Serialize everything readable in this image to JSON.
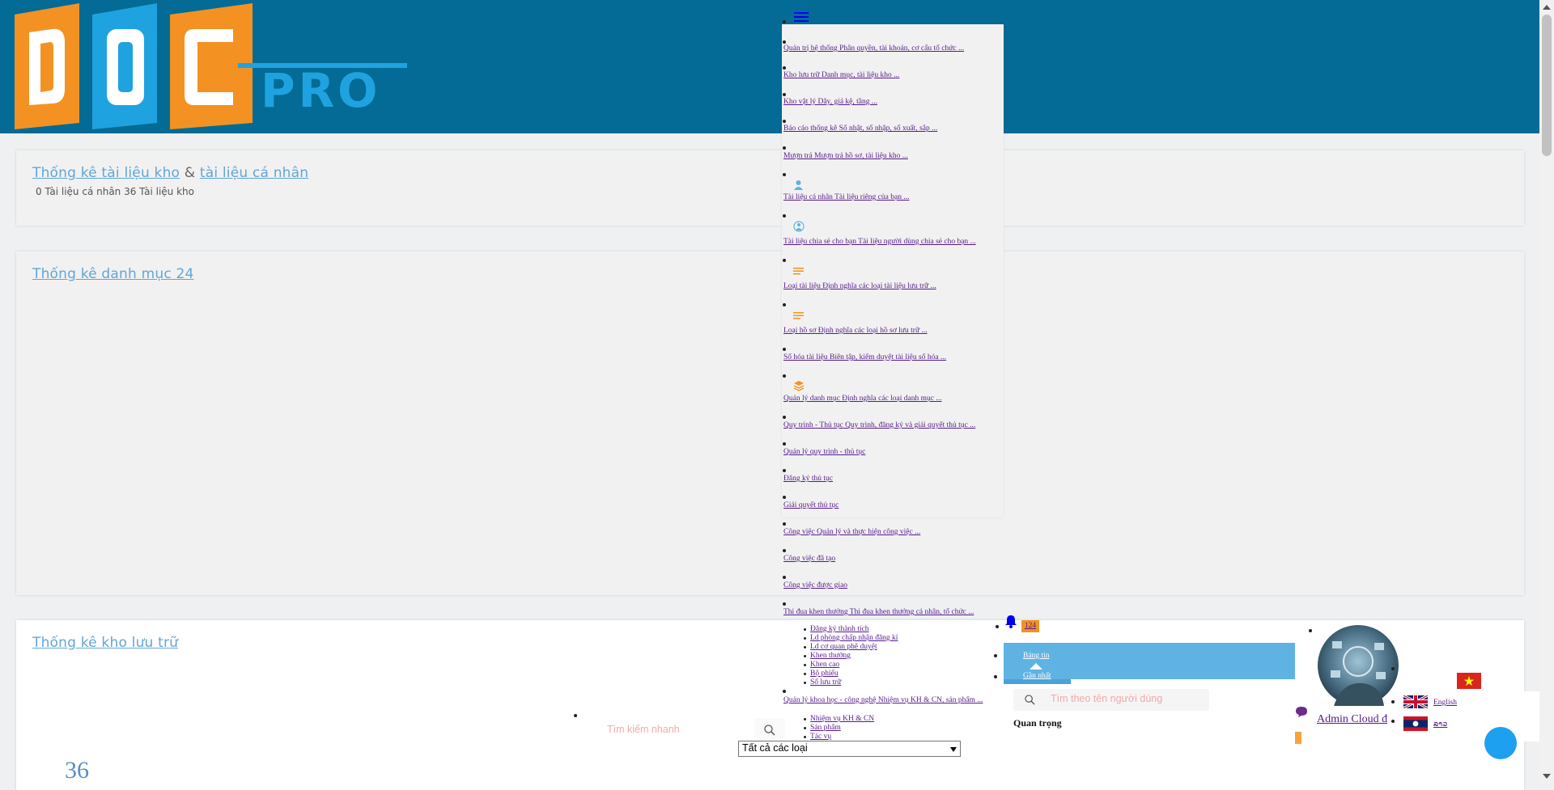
{
  "brand": {
    "logo_text": "DOC PRO",
    "colors": {
      "header": "#036b95",
      "orange": "#f39222",
      "blue": "#1fa2e0",
      "link": "#62a6d6"
    }
  },
  "header": {
    "menu_icon": "hamburger-icon"
  },
  "stats_card": {
    "title_link1": "Thống kê tài liệu kho",
    "amp": "&",
    "title_link2": "tài liệu cá nhân",
    "subtitle": "0 Tài liệu cá nhân  36 Tài liệu kho"
  },
  "category_card": {
    "title": "Thống kê danh mục 24"
  },
  "storage_card": {
    "title": "Thống kê kho lưu trữ",
    "count": "36"
  },
  "menu": {
    "items": [
      {
        "label": "Quản trị hệ thống Phân quyền, tài khoản, cơ cấu tổ chức ..."
      },
      {
        "label": "Kho lưu trữ Danh mục, tài liệu kho ..."
      },
      {
        "label": "Kho vật lý Dãy, giá kệ, tầng ..."
      },
      {
        "label": "Báo cáo thống kê Số nhật, số nhập, số xuất, sắp ..."
      },
      {
        "label": "Mượn trả Mượn trả hồ sơ, tài liệu kho ..."
      },
      {
        "label": "Tài liệu cá nhân Tài liệu riêng của bạn ..."
      },
      {
        "label": "Tài liệu chia sẻ cho bạn Tài liệu người dùng chia sẻ cho bạn ..."
      },
      {
        "label": "Loại tài liệu Định nghĩa các loại tài liệu lưu trữ ..."
      },
      {
        "label": "Loại hồ sơ Định nghĩa các loại hồ sơ lưu trữ ..."
      },
      {
        "label": "Số hóa tài liệu Biên tập, kiểm duyệt tài liệu số hóa ..."
      },
      {
        "label": "Quản lý danh mục Định nghĩa các loại danh mục ..."
      },
      {
        "label": "Quy trình - Thủ tục Quy trình, đăng ký và giải quyết thủ tục ..."
      },
      {
        "label": "Quản lý quy trình - thủ tục"
      },
      {
        "label": "Đăng ký thủ tục"
      },
      {
        "label": "Giải quyết thủ tục"
      },
      {
        "label": "Công việc Quản lý và thực hiện công việc ..."
      },
      {
        "label": "Công việc đã tạo"
      },
      {
        "label": "Công việc được giao"
      },
      {
        "label": "Thi đua khen thưởng Thi đua khen thưởng cá nhân, tổ chức ..."
      },
      {
        "label": "Quản lý khoa học - công nghệ Nhiệm vụ KH & CN, sản phẩm ..."
      }
    ],
    "sub_awards": [
      "Đăng ký thành tích",
      "Ld phòng chấp nhận đăng kí",
      "Ld cơ quan phê duyệt",
      "Khen thưởng",
      "Khen cao",
      "Bộ phiếu",
      "Sổ lưu trữ"
    ],
    "sub_science": [
      "Nhiệm vụ KH & CN",
      "Sản phẩm",
      "Tác vụ"
    ]
  },
  "notifications": {
    "count": "124",
    "tab_news": "Bảng tin",
    "tab_recent": "Gần nhất",
    "search_placeholder": "Tìm theo tên người dùng",
    "important": "Quan trọng"
  },
  "quick_search": {
    "placeholder": "Tìm kiếm nhanh",
    "filter_value": "Tất cả các loại"
  },
  "user": {
    "name": "Admin Cloud đ"
  },
  "languages": {
    "english": "English",
    "lao": "ລາວ"
  }
}
